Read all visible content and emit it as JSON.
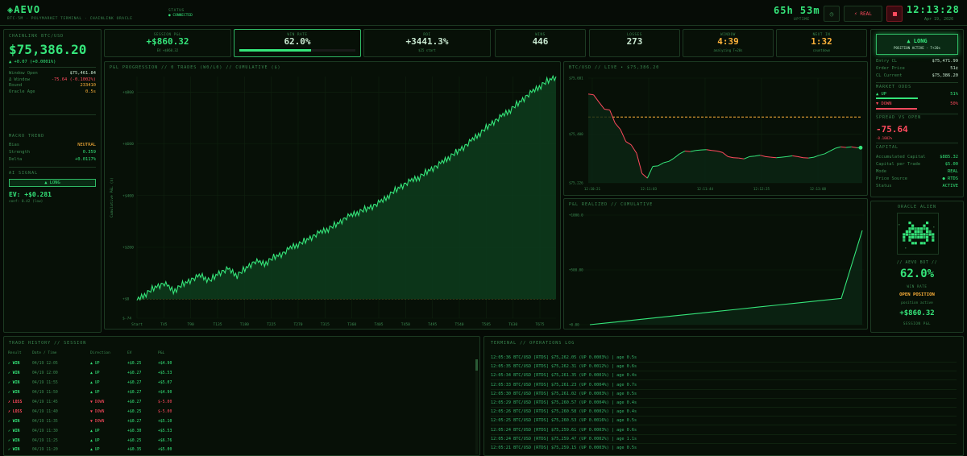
{
  "header": {
    "brand": "◈AEVO",
    "subtitle": "BTC-5M · POLYMARKET TERMINAL · CHAINLINK ORACLE",
    "status_label": "STATUS",
    "status_value": "● CONNECTED",
    "uptime": "65h 53m",
    "uptime_label": "UPTIME",
    "mode_button": "⚡ REAL",
    "clock": "12:13:28",
    "date": "Apr 19, 2026"
  },
  "left_panel": {
    "title": "CHAINLINK BTC/USD",
    "price": "$75,386.20",
    "change": "▲ +0.07 (+0.0001%)",
    "rows": [
      {
        "k": "Window Open",
        "v": "$75,461.84",
        "c": "white"
      },
      {
        "k": "Δ Window",
        "v": "-75.64 (-0.1002%)",
        "c": "red"
      },
      {
        "k": "Round",
        "v": "233410",
        "c": "amber"
      },
      {
        "k": "Oracle Age",
        "v": "0.5s",
        "c": "amber"
      }
    ],
    "macro_title": "MACRO TREND",
    "macro_rows": [
      {
        "k": "Bias",
        "v": "NEUTRAL",
        "c": "amber"
      },
      {
        "k": "Strength",
        "v": "0.359",
        "c": "green"
      },
      {
        "k": "Delta",
        "v": "+0.0117%",
        "c": "green"
      }
    ],
    "signal_title": "AI SIGNAL",
    "signal_button": "▲ LONG",
    "ev": "EV: +$0.281",
    "ev_sub": "conf: 0.42 (low)"
  },
  "stats": [
    {
      "label": "SESSION P&L",
      "value": "+$860.32",
      "sub": "EV +$860.32",
      "color": "green"
    },
    {
      "label": "WIN RATE",
      "value": "62.0%",
      "sub": "",
      "color": "white",
      "progress": 0.62
    },
    {
      "label": "ROI",
      "value": "+3441.3%",
      "sub": "$25 start",
      "color": "white"
    },
    {
      "label": "WINS",
      "value": "446",
      "sub": "",
      "color": "white"
    },
    {
      "label": "LOSSES",
      "value": "273",
      "sub": "",
      "color": "white"
    },
    {
      "label": "WINDOW",
      "value": "4:39",
      "sub": "analyzing T+20s",
      "color": "amber"
    },
    {
      "label": "NEXT IN",
      "value": "1:32",
      "sub": "countdown",
      "color": "amber"
    }
  ],
  "pnl_chart_title": "P&L PROGRESSION // 0 TRADES (W0/L0) // CUMULATIVE ($)",
  "btc_chart_title": "BTC/USD // LIVE • $75,386.20",
  "realized_chart_title": "P&L REALIZED // CUMULATIVE",
  "chart_data": [
    {
      "type": "area",
      "ylabel": "Cumulative P&L ($)",
      "x_ticks": [
        "Start",
        "T45",
        "T90",
        "T135",
        "T180",
        "T225",
        "T270",
        "T315",
        "T360",
        "T405",
        "T450",
        "T495",
        "T540",
        "T585",
        "T630",
        "T675"
      ],
      "y_ticks": [
        "+$800",
        "+$600",
        "+$400",
        "+$200",
        "+$0",
        "$-74"
      ],
      "y_tick_values": [
        800,
        600,
        400,
        200,
        0,
        -74
      ],
      "ylim": [
        -74,
        860
      ],
      "series": [
        {
          "values": [
            -5,
            20,
            45,
            60,
            30,
            55,
            75,
            90,
            70,
            100,
            115,
            90,
            120,
            145,
            135,
            160,
            175,
            200,
            215,
            235,
            255,
            270,
            290,
            315,
            330,
            345,
            360,
            380,
            410,
            435,
            455,
            470,
            495,
            515,
            540,
            565,
            590,
            620,
            650,
            680,
            705,
            730,
            760,
            790,
            815,
            840,
            860
          ]
        }
      ]
    },
    {
      "type": "line",
      "y_ticks": [
        "$75,601",
        "$75,400",
        "$75,226"
      ],
      "y_tick_values": [
        75601,
        75400,
        75226
      ],
      "x_ticks": [
        "12:10:21",
        "12:11:03",
        "12:11:44",
        "12:12:25",
        "12:13:08"
      ],
      "ylim": [
        75226,
        75601
      ],
      "reference_line": 75461.84,
      "series": [
        {
          "values": [
            75544,
            75541,
            75515,
            75490,
            75487,
            75440,
            75417,
            75374,
            75362,
            75332,
            75260,
            75243,
            75285,
            75287,
            75298,
            75303,
            75315,
            75330,
            75340,
            75338,
            75342,
            75344,
            75345,
            75342,
            75340,
            75335,
            75320,
            75316,
            75315,
            75312,
            75320,
            75322,
            75325,
            75320,
            75318,
            75316,
            75318,
            75320,
            75323,
            75320,
            75316,
            75315,
            75318,
            75325,
            75330,
            75340,
            75350,
            75355,
            75353,
            75355,
            75352,
            75352
          ]
        }
      ]
    },
    {
      "type": "line",
      "y_ticks": [
        "+1000.0",
        "+500.00",
        "+0.00"
      ],
      "y_tick_values": [
        1000,
        500,
        0
      ],
      "ylim": [
        0,
        1000
      ],
      "series": [
        {
          "values": [
            0,
            20,
            40,
            60,
            80,
            100,
            120,
            140,
            160,
            180,
            200,
            220,
            240,
            860
          ]
        }
      ]
    }
  ],
  "right_panel": {
    "long_button": "▲ LONG",
    "long_sub": "POSITION ACTIVE - T+20s",
    "rows": [
      {
        "k": "Entry CL",
        "v": "$75,471.99",
        "c": "white"
      },
      {
        "k": "Order Price",
        "v": "51¢",
        "c": "white"
      },
      {
        "k": "CL Current",
        "v": "$75,386.20",
        "c": "white"
      }
    ],
    "market_title": "MARKET ODDS",
    "up_label": "▲ UP",
    "up_value": "51%",
    "up_pct": 0.51,
    "down_label": "▼ DOWN",
    "down_value": "50%",
    "down_pct": 0.5,
    "spread_title": "SPREAD VS OPEN",
    "spread_value": "-75.64",
    "spread_sub": "-0.1002%",
    "capital_title": "CAPITAL",
    "capital_rows": [
      {
        "k": "Accumulated Capital",
        "v": "$885.32",
        "c": "green"
      },
      {
        "k": "Capital per Trade",
        "v": "$5.00",
        "c": "green"
      },
      {
        "k": "Mode",
        "v": "REAL",
        "c": "green"
      },
      {
        "k": "Price Source",
        "v": "● RTDS",
        "c": "green"
      },
      {
        "k": "Status",
        "v": "ACTIVE",
        "c": "green"
      }
    ]
  },
  "alien_panel": {
    "title": "ORACLE ALIEN",
    "caption": "// AEVO BOT //",
    "win_rate": "62.0%",
    "win_rate_label": "WIN RATE",
    "status": "OPEN POSITION",
    "status_sub": "position active",
    "pnl": "+$860.32",
    "pnl_label": "SESSION P&L"
  },
  "trade_history": {
    "title": "TRADE HISTORY // SESSION",
    "columns": [
      "Result",
      "Date / Time",
      "Direction",
      "EV",
      "P&L"
    ],
    "rows": [
      {
        "result": "✓ WIN",
        "time": "04/19 12:05",
        "dir": "▲ UP",
        "ev": "+$0.25",
        "pnl": "+$4.90",
        "win": true,
        "up": true
      },
      {
        "result": "✓ WIN",
        "time": "04/19 12:00",
        "dir": "▲ UP",
        "ev": "+$0.27",
        "pnl": "+$5.53",
        "win": true,
        "up": true
      },
      {
        "result": "✓ WIN",
        "time": "04/19 11:55",
        "dir": "▲ UP",
        "ev": "+$0.27",
        "pnl": "+$5.07",
        "win": true,
        "up": true
      },
      {
        "result": "✓ WIN",
        "time": "04/19 11:50",
        "dir": "▲ UP",
        "ev": "+$0.27",
        "pnl": "+$4.90",
        "win": true,
        "up": true
      },
      {
        "result": "✗ LOSS",
        "time": "04/19 11:45",
        "dir": "▼ DOWN",
        "ev": "+$0.27",
        "pnl": "$-5.00",
        "win": false,
        "up": false
      },
      {
        "result": "✗ LOSS",
        "time": "04/19 11:40",
        "dir": "▼ DOWN",
        "ev": "+$0.25",
        "pnl": "$-5.00",
        "win": false,
        "up": false
      },
      {
        "result": "✓ WIN",
        "time": "04/19 11:35",
        "dir": "▼ DOWN",
        "ev": "+$0.27",
        "pnl": "+$5.10",
        "win": true,
        "up": false
      },
      {
        "result": "✓ WIN",
        "time": "04/19 11:30",
        "dir": "▲ UP",
        "ev": "+$0.30",
        "pnl": "+$5.53",
        "win": true,
        "up": true
      },
      {
        "result": "✓ WIN",
        "time": "04/19 11:25",
        "dir": "▲ UP",
        "ev": "+$0.25",
        "pnl": "+$6.76",
        "win": true,
        "up": true
      },
      {
        "result": "✓ WIN",
        "time": "04/19 11:20",
        "dir": "▲ UP",
        "ev": "+$0.35",
        "pnl": "+$5.00",
        "win": true,
        "up": true
      }
    ]
  },
  "ops_log": {
    "title": "TERMINAL // OPERATIONS LOG",
    "lines": [
      "12:05:36 BTC/USD [RTDS] $75,262.05 (UP 0.0003%) | age 0.5s",
      "12:05:35 BTC/USD [RTDS] $75,262.31 (UP 0.0012%) | age 0.6s",
      "12:05:34 BTC/USD [RTDS] $75,261.35 (UP 0.0001%) | age 0.4s",
      "12:05:33 BTC/USD [RTDS] $75,261.23 (UP 0.0004%) | age 0.7s",
      "12:05:30 BTC/USD [RTDS] $75,261.02 (UP 0.0003%) | age 0.5s",
      "12:05:29 BTC/USD [RTDS] $75,260.57 (UP 0.0004%) | age 0.4s",
      "12:05:26 BTC/USD [RTDS] $75,260.58 (UP 0.0002%) | age 0.4s",
      "12:05:25 BTC/USD [RTDS] $75,260.53 (UP 0.0016%) | age 0.5s",
      "12:05:24 BTC/USD [RTDS] $75,259.61 (UP 0.0003%) | age 0.6s",
      "12:05:24 BTC/USD [RTDS] $75,259.47 (UP 0.0002%) | age 1.1s",
      "12:05:21 BTC/USD [RTDS] $75,259.15 (UP 0.0003%) | age 0.5s"
    ]
  }
}
